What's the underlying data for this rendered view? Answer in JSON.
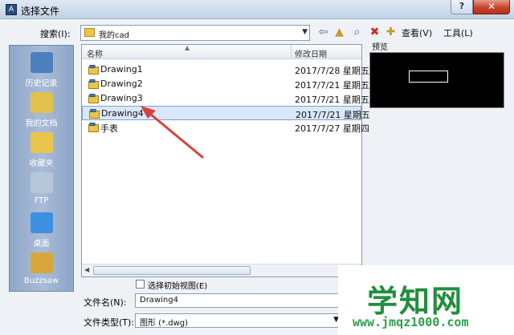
{
  "window": {
    "title": "选择文件",
    "help_glyph": "?",
    "close_glyph": "✕"
  },
  "toolbar": {
    "search_label": "搜索(I):",
    "look_in_value": "我的cad",
    "view_label": "查看(V)",
    "tools_label": "工具(L)"
  },
  "places": [
    {
      "label": "历史记录",
      "color": "#4d7fbd"
    },
    {
      "label": "我的文档",
      "color": "#e1c14b"
    },
    {
      "label": "收藏夹",
      "color": "#e9c64a"
    },
    {
      "label": "FTP",
      "color": "#b7c7da"
    },
    {
      "label": "桌面",
      "color": "#3d8fe0"
    },
    {
      "label": "Buzzsaw",
      "color": "#d9a63c"
    }
  ],
  "list": {
    "col_name": "名称",
    "col_date": "修改日期",
    "rows": [
      {
        "name": "Drawing1",
        "date": "2017/7/28 星期五",
        "selected": false,
        "kind": "dwg"
      },
      {
        "name": "Drawing2",
        "date": "2017/7/21 星期五",
        "selected": false,
        "kind": "dwg"
      },
      {
        "name": "Drawing3",
        "date": "2017/7/21 星期五",
        "selected": false,
        "kind": "dwg"
      },
      {
        "name": "Drawing4",
        "date": "2017/7/21 星期五",
        "selected": true,
        "kind": "dwg"
      },
      {
        "name": "手表",
        "date": "2017/7/27 星期四",
        "selected": false,
        "kind": "dwg"
      }
    ]
  },
  "preview": {
    "label": "预览"
  },
  "options": {
    "initial_view_label": "选择初始视图(E)"
  },
  "filename": {
    "label": "文件名(N):",
    "value": "Drawing4"
  },
  "filetype": {
    "label": "文件类型(T):",
    "value": "图形 (*.dwg)"
  },
  "watermark": {
    "main": "学知网",
    "sub": "www.jmqz1000.com"
  },
  "colors": {
    "accent_arrow": "#d9413a",
    "selection_bg": "#d9e8fb",
    "watermark_green": "#1f8f3b"
  }
}
